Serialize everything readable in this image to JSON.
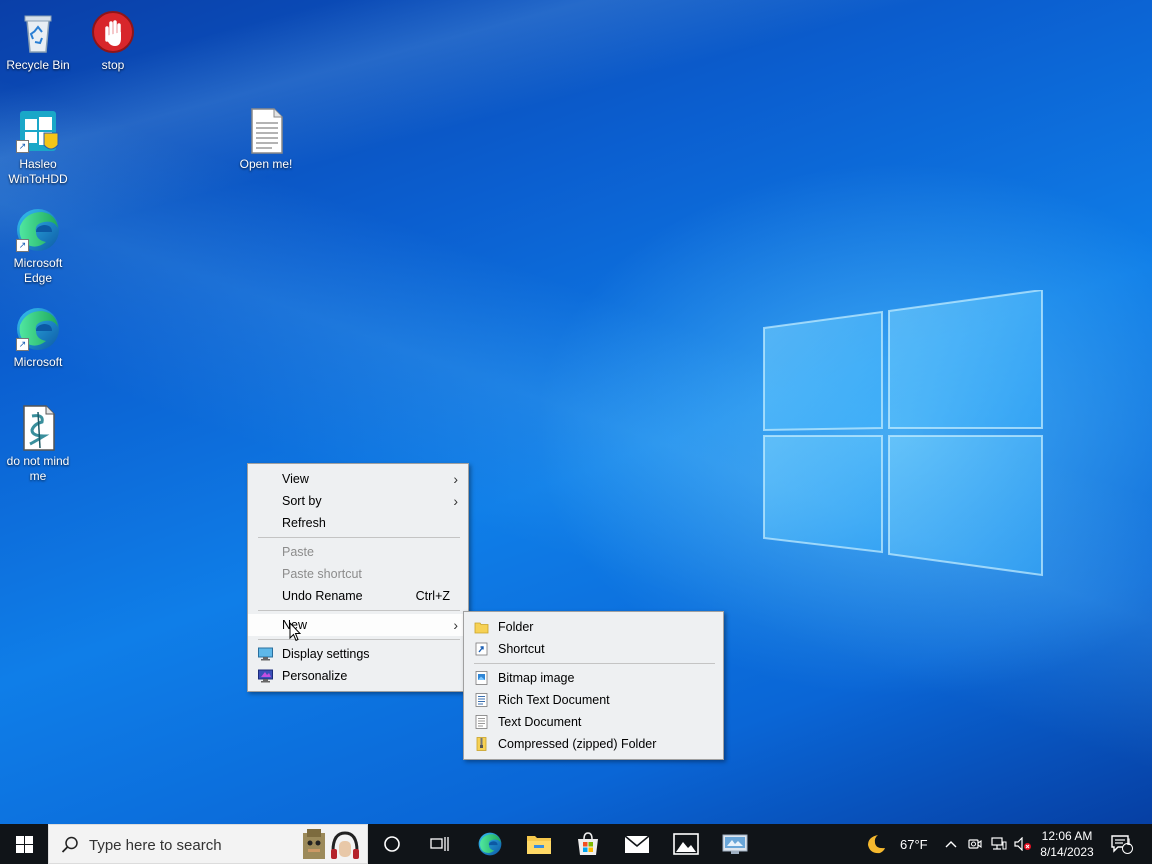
{
  "desktop_icons": [
    {
      "label": "Recycle Bin",
      "icon": "recycle-bin-icon"
    },
    {
      "label": "stop",
      "icon": "stop-hand-icon"
    },
    {
      "label": "Hasleo WinToHDD",
      "icon": "wintohdd-icon"
    },
    {
      "label": "Open me!",
      "icon": "text-file-icon"
    },
    {
      "label": "Microsoft Edge",
      "icon": "edge-icon"
    },
    {
      "label": "Microsoft",
      "icon": "edge-icon"
    },
    {
      "label": "do not mind me",
      "icon": "script-file-icon"
    }
  ],
  "context_menu": {
    "view": "View",
    "sort_by": "Sort by",
    "refresh": "Refresh",
    "paste": "Paste",
    "paste_shortcut": "Paste shortcut",
    "undo_rename": "Undo Rename",
    "undo_rename_accel": "Ctrl+Z",
    "new": "New",
    "display_settings": "Display settings",
    "personalize": "Personalize"
  },
  "new_submenu": {
    "folder": "Folder",
    "shortcut": "Shortcut",
    "bitmap": "Bitmap image",
    "rtf": "Rich Text Document",
    "text": "Text Document",
    "zip": "Compressed (zipped) Folder"
  },
  "taskbar": {
    "search_placeholder": "Type here to search",
    "apps": [
      "task-view-icon",
      "edge-icon",
      "file-explorer-icon",
      "store-icon",
      "mail-icon",
      "photos-icon",
      "control-panel-icon"
    ],
    "weather": "67°F",
    "time": "12:06 AM",
    "date": "8/14/2023",
    "notifications_count": "1"
  },
  "colors": {
    "taskbar": "#101418",
    "menu_bg": "#eef0f2",
    "accent": "#0078d7"
  }
}
